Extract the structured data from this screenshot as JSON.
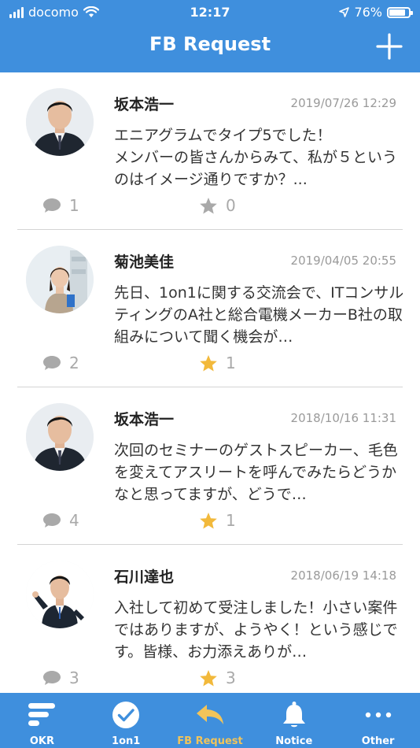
{
  "status_bar": {
    "carrier": "docomo",
    "time": "12:17",
    "battery": "76%",
    "battery_level": 0.76
  },
  "header": {
    "title": "FB Request"
  },
  "colors": {
    "primary": "#3f8fdd",
    "active_tab": "#f2c45a",
    "star_on": "#f2b93b",
    "icon_gray": "#a9a9a9"
  },
  "posts": [
    {
      "name": "坂本浩一",
      "date": "2019/07/26 12:29",
      "body": "エニアグラムでタイプ5でした！\nメンバーの皆さんからみて、私が５というのはイメージ通りですか？...",
      "comments": "1",
      "stars": "0",
      "starred": false
    },
    {
      "name": "菊池美佳",
      "date": "2019/04/05 20:55",
      "body": "先日、1on1に関する交流会で、ITコンサルティングのA社と総合電機メーカーB社の取組みについて聞く機会が…",
      "comments": "2",
      "stars": "1",
      "starred": true
    },
    {
      "name": "坂本浩一",
      "date": "2018/10/16 11:31",
      "body": "次回のセミナーのゲストスピーカー、毛色を変えてアスリートを呼んでみたらどうかなと思ってますが、どうで…",
      "comments": "4",
      "stars": "1",
      "starred": true
    },
    {
      "name": "石川達也",
      "date": "2018/06/19 14:18",
      "body": "入社して初めて受注しました！小さい案件ではありますが、ようやく！という感じです。皆様、お力添えありが…",
      "comments": "3",
      "stars": "3",
      "starred": true
    }
  ],
  "tabs": [
    {
      "label": "OKR",
      "icon": "okr-icon"
    },
    {
      "label": "1on1",
      "icon": "check-circle-icon"
    },
    {
      "label": "FB Request",
      "icon": "reply-arrow-icon",
      "active": true
    },
    {
      "label": "Notice",
      "icon": "bell-icon"
    },
    {
      "label": "Other",
      "icon": "more-dots-icon"
    }
  ]
}
